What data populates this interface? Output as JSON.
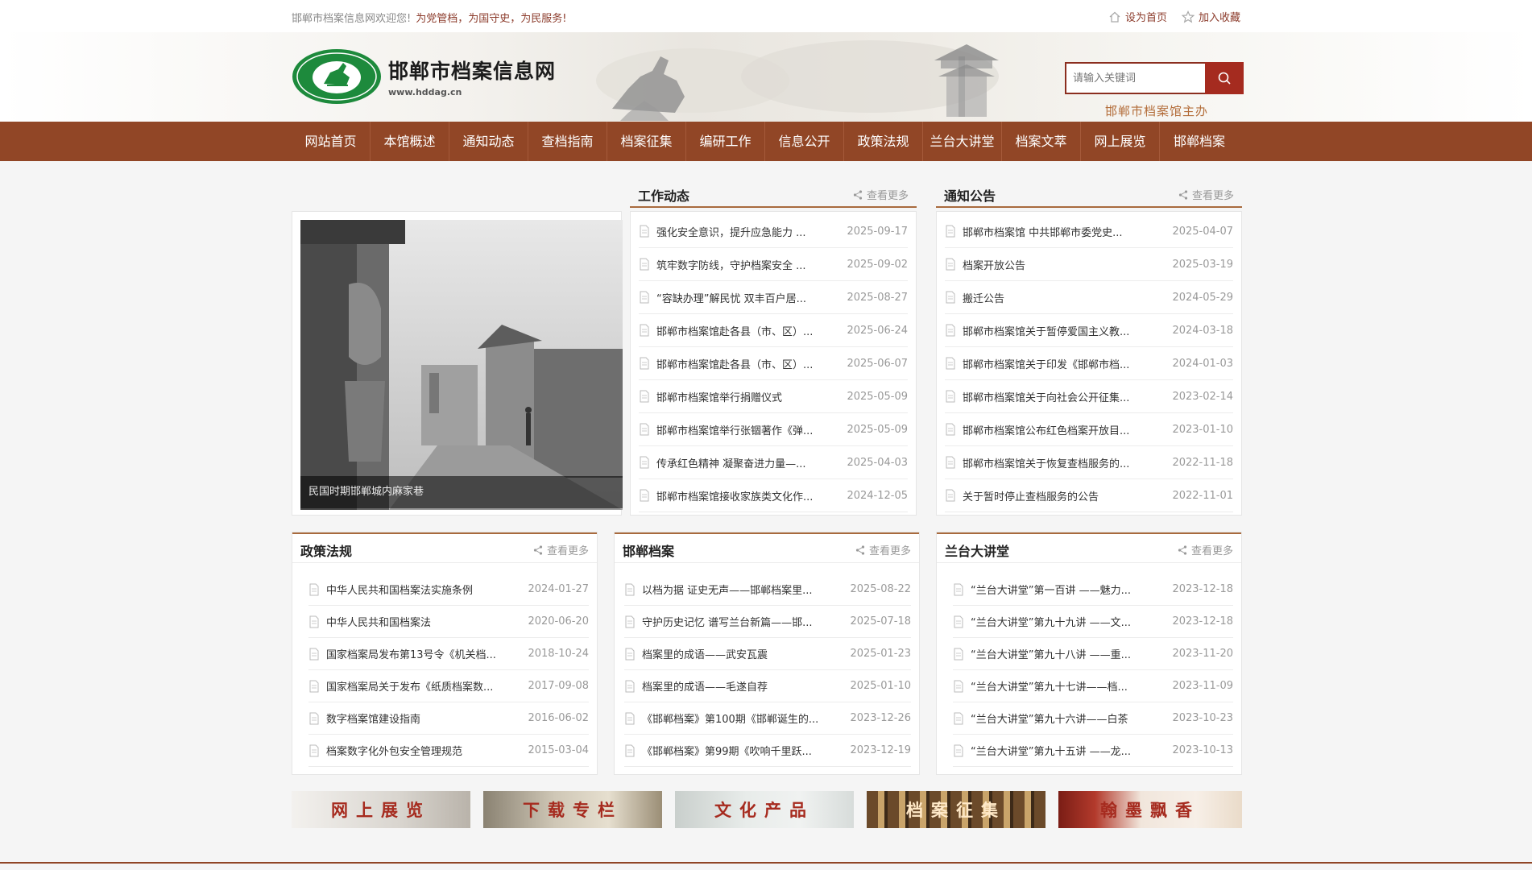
{
  "topbar": {
    "welcome": "邯郸市档案信息网欢迎您!",
    "slogan": "为党管档，为国守史，为民服务!",
    "set_home": "设为首页",
    "add_favorite": "加入收藏"
  },
  "header": {
    "site_name": "邯郸市档案信息网",
    "site_url": "www.hddag.cn",
    "search_placeholder": "请输入关键词",
    "sponsor": "邯郸市档案馆主办"
  },
  "nav": [
    "网站首页",
    "本馆概述",
    "通知动态",
    "查档指南",
    "档案征集",
    "编研工作",
    "信息公开",
    "政策法规",
    "兰台大讲堂",
    "档案文萃",
    "网上展览",
    "邯郸档案"
  ],
  "slideshow": {
    "caption": "民国时期邯郸城内麻家巷"
  },
  "more_label": "查看更多",
  "work_news": {
    "title": "工作动态",
    "items": [
      {
        "text": "强化安全意识，提升应急能力 ...",
        "date": "2025-09-17"
      },
      {
        "text": "筑牢数字防线，守护档案安全 ...",
        "date": "2025-09-02"
      },
      {
        "text": "“容缺办理”解民忧 双丰百户居...",
        "date": "2025-08-27"
      },
      {
        "text": "邯郸市档案馆赴各县（市、区）...",
        "date": "2025-06-24"
      },
      {
        "text": "邯郸市档案馆赴各县（市、区）...",
        "date": "2025-06-07"
      },
      {
        "text": "邯郸市档案馆举行捐赠仪式",
        "date": "2025-05-09"
      },
      {
        "text": "邯郸市档案馆举行张锢著作《弹...",
        "date": "2025-05-09"
      },
      {
        "text": "传承红色精神 凝聚奋进力量—...",
        "date": "2025-04-03"
      },
      {
        "text": "邯郸市档案馆接收家族类文化作...",
        "date": "2024-12-05"
      }
    ]
  },
  "notices": {
    "title": "通知公告",
    "items": [
      {
        "text": "邯郸市档案馆 中共邯郸市委党史...",
        "date": "2025-04-07"
      },
      {
        "text": "档案开放公告",
        "date": "2025-03-19"
      },
      {
        "text": "搬迁公告",
        "date": "2024-05-29"
      },
      {
        "text": "邯郸市档案馆关于暂停爱国主义教...",
        "date": "2024-03-18"
      },
      {
        "text": "邯郸市档案馆关于印发《邯郸市档...",
        "date": "2024-01-03"
      },
      {
        "text": "邯郸市档案馆关于向社会公开征集...",
        "date": "2023-02-14"
      },
      {
        "text": "邯郸市档案馆公布红色档案开放目...",
        "date": "2023-01-10"
      },
      {
        "text": "邯郸市档案馆关于恢复查档服务的...",
        "date": "2022-11-18"
      },
      {
        "text": "关于暂时停止查档服务的公告",
        "date": "2022-11-01"
      }
    ]
  },
  "policy": {
    "title": "政策法规",
    "items": [
      {
        "text": "中华人民共和国档案法实施条例",
        "date": "2024-01-27"
      },
      {
        "text": "中华人民共和国档案法",
        "date": "2020-06-20"
      },
      {
        "text": "国家档案局发布第13号令《机关档...",
        "date": "2018-10-24"
      },
      {
        "text": "国家档案局关于发布《纸质档案数...",
        "date": "2017-09-08"
      },
      {
        "text": "数字档案馆建设指南",
        "date": "2016-06-02"
      },
      {
        "text": "档案数字化外包安全管理规范",
        "date": "2015-03-04"
      }
    ]
  },
  "handan_archives": {
    "title": "邯郸档案",
    "items": [
      {
        "text": "以档为据 证史无声——邯郸档案里...",
        "date": "2025-08-22"
      },
      {
        "text": "守护历史记忆 谱写兰台新篇——邯...",
        "date": "2025-07-18"
      },
      {
        "text": "档案里的成语——武安瓦震",
        "date": "2025-01-23"
      },
      {
        "text": "档案里的成语——毛遂自荐",
        "date": "2025-01-10"
      },
      {
        "text": "《邯郸档案》第100期《邯郸诞生的...",
        "date": "2023-12-26"
      },
      {
        "text": "《邯郸档案》第99期《吹响千里跃...",
        "date": "2023-12-19"
      }
    ]
  },
  "lantai": {
    "title": "兰台大讲堂",
    "items": [
      {
        "text": "“兰台大讲堂”第一百讲 ——魅力...",
        "date": "2023-12-18"
      },
      {
        "text": "“兰台大讲堂”第九十九讲 ——文...",
        "date": "2023-12-18"
      },
      {
        "text": "“兰台大讲堂”第九十八讲 ——重...",
        "date": "2023-11-20"
      },
      {
        "text": "“兰台大讲堂”第九十七讲——档...",
        "date": "2023-11-09"
      },
      {
        "text": "“兰台大讲堂”第九十六讲——白茶",
        "date": "2023-10-23"
      },
      {
        "text": "“兰台大讲堂”第九十五讲 ——龙...",
        "date": "2023-10-13"
      }
    ]
  },
  "banners": [
    "网上展览",
    "下载专栏",
    "文化产品",
    "档案征集",
    "翰墨飘香"
  ],
  "colors": {
    "brand": "#914626",
    "accent": "#a52b1f",
    "title_line": "#a86a3d"
  }
}
